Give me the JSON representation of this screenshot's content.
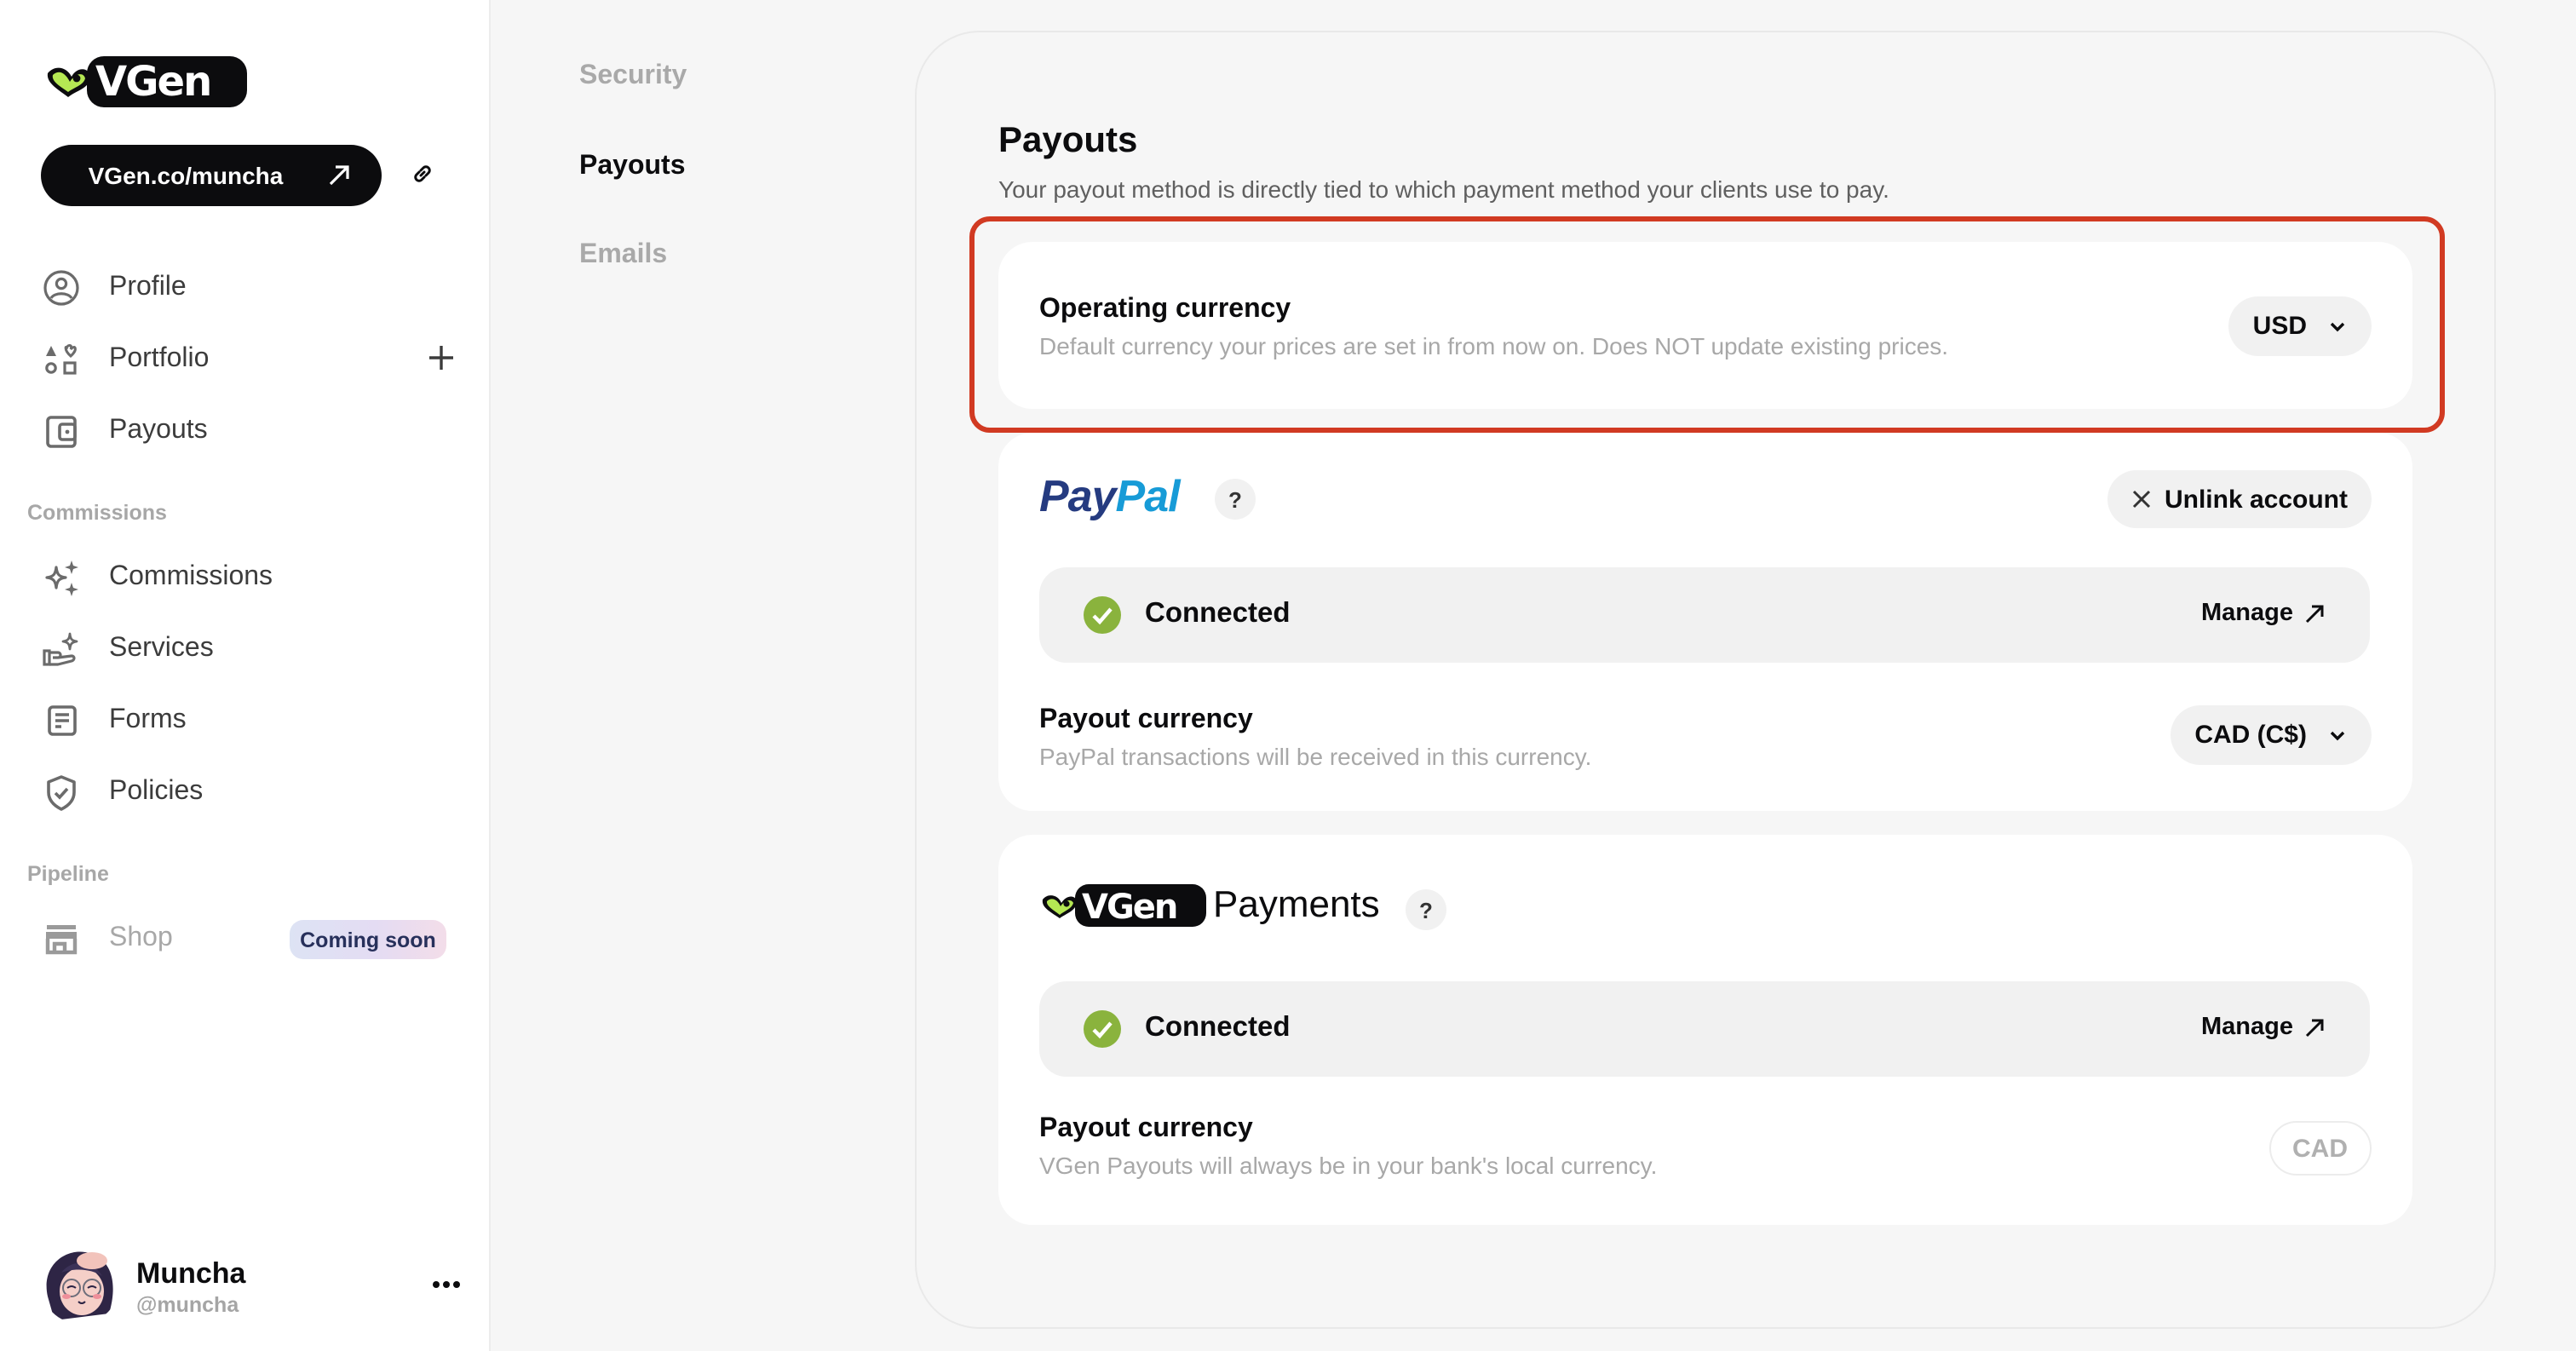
{
  "sidebar": {
    "brand": "VGen",
    "profile_url_label": "VGen.co/muncha",
    "items": [
      {
        "label": "Profile",
        "icon": "user-circle-icon"
      },
      {
        "label": "Portfolio",
        "icon": "shapes-icon",
        "action": "add-icon"
      },
      {
        "label": "Payouts",
        "icon": "wallet-icon"
      }
    ],
    "sections": [
      {
        "label": "Commissions",
        "items": [
          {
            "label": "Commissions",
            "icon": "sparkles-icon"
          },
          {
            "label": "Services",
            "icon": "hand-sparkle-icon"
          },
          {
            "label": "Forms",
            "icon": "form-icon"
          },
          {
            "label": "Policies",
            "icon": "shield-check-icon"
          }
        ]
      },
      {
        "label": "Pipeline",
        "items": [
          {
            "label": "Shop",
            "icon": "store-icon",
            "badge": "Coming soon",
            "disabled": true
          }
        ]
      }
    ],
    "user": {
      "name": "Muncha",
      "handle": "@muncha"
    }
  },
  "settings_nav": {
    "items": [
      {
        "label": "Security",
        "active": false
      },
      {
        "label": "Payouts",
        "active": true
      },
      {
        "label": "Emails",
        "active": false
      }
    ]
  },
  "main": {
    "title": "Payouts",
    "subtitle": "Your payout method is directly tied to which payment method your clients use to pay.",
    "operating_currency": {
      "title": "Operating currency",
      "description": "Default currency your prices are set in from now on. Does NOT update existing prices.",
      "value": "USD",
      "highlighted": true
    },
    "paypal": {
      "logo_part1": "Pay",
      "logo_part2": "Pal",
      "help": "?",
      "unlink_label": "Unlink account",
      "status": "Connected",
      "manage_label": "Manage",
      "payout_currency_title": "Payout currency",
      "payout_currency_desc": "PayPal transactions will be received in this currency.",
      "payout_currency_value": "CAD (C$)"
    },
    "vgen_payments": {
      "title": "Payments",
      "help": "?",
      "status": "Connected",
      "manage_label": "Manage",
      "payout_currency_title": "Payout currency",
      "payout_currency_desc": "VGen Payouts will always be in your bank's local currency.",
      "payout_currency_value": "CAD"
    }
  },
  "colors": {
    "accent_green": "#b5e853",
    "highlight_red": "#d13a22",
    "success_green": "#8ab33d",
    "paypal_dark": "#253b80",
    "paypal_light": "#179bd7"
  }
}
